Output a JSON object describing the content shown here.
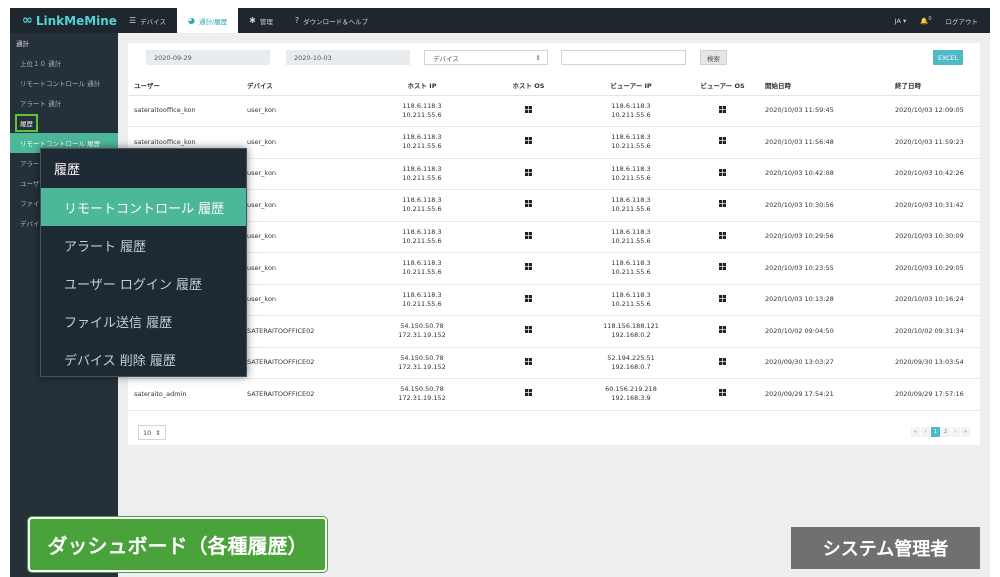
{
  "app": {
    "logo_text": "LinkMeMine"
  },
  "nav": {
    "tabs": [
      {
        "label": "デバイス",
        "icon": "list-icon"
      },
      {
        "label": "通計/履歴",
        "icon": "pie-chart-icon"
      },
      {
        "label": "管理",
        "icon": "gear-icon"
      },
      {
        "label": "ダウンロード＆ヘルプ",
        "icon": "help-icon"
      }
    ],
    "lang": "JA ▾",
    "bell_count": "0",
    "logout": "ログアウト"
  },
  "sidebar": {
    "items": [
      "通計",
      "上位１０ 通計",
      "リモートコントロール 通計",
      "アラート 通計",
      "履歴",
      "リモートコントロール 履歴",
      "アラート 履歴",
      "ユーザー ログイン 履歴",
      "ファイル送信 履歴",
      "デバイス 削除 履歴"
    ]
  },
  "filters": {
    "date_from": "2020-09-29",
    "date_to": "2020-10-03",
    "device_select": "デバイス",
    "search_value": "",
    "search_button": "検索",
    "excel_button": "EXCEL"
  },
  "table": {
    "headers": [
      "ユーザー",
      "デバイス",
      "ホスト IP",
      "ホスト OS",
      "ビューアー IP",
      "ビューアー OS",
      "開始日時",
      "終了日時"
    ],
    "rows": [
      {
        "user": "sateraitooffice_kon",
        "device": "user_kon",
        "host_ip1": "118.6.118.3",
        "host_ip2": "10.211.55.6",
        "viewer_ip1": "118.6.118.3",
        "viewer_ip2": "10.211.55.6",
        "start": "2020/10/03 11:59:45",
        "end": "2020/10/03 12:09:05"
      },
      {
        "user": "sateraitooffice_kon",
        "device": "user_kon",
        "host_ip1": "118.6.118.3",
        "host_ip2": "10.211.55.6",
        "viewer_ip1": "118.6.118.3",
        "viewer_ip2": "10.211.55.6",
        "start": "2020/10/03 11:56:48",
        "end": "2020/10/03 11:59:23"
      },
      {
        "user": "",
        "device": "user_kon",
        "host_ip1": "118.6.118.3",
        "host_ip2": "10.211.55.6",
        "viewer_ip1": "118.6.118.3",
        "viewer_ip2": "10.211.55.6",
        "start": "2020/10/03 10:42:08",
        "end": "2020/10/03 10:42:26"
      },
      {
        "user": "",
        "device": "user_kon",
        "host_ip1": "118.6.118.3",
        "host_ip2": "10.211.55.6",
        "viewer_ip1": "118.6.118.3",
        "viewer_ip2": "10.211.55.6",
        "start": "2020/10/03 10:30:56",
        "end": "2020/10/03 10:31:42"
      },
      {
        "user": "",
        "device": "user_kon",
        "host_ip1": "118.6.118.3",
        "host_ip2": "10.211.55.6",
        "viewer_ip1": "118.6.118.3",
        "viewer_ip2": "10.211.55.6",
        "start": "2020/10/03 10:29:56",
        "end": "2020/10/03 10:30:09"
      },
      {
        "user": "",
        "device": "user_kon",
        "host_ip1": "118.6.118.3",
        "host_ip2": "10.211.55.6",
        "viewer_ip1": "118.6.118.3",
        "viewer_ip2": "10.211.55.6",
        "start": "2020/10/03 10:23:55",
        "end": "2020/10/03 10:29:05"
      },
      {
        "user": "",
        "device": "user_kon",
        "host_ip1": "118.6.118.3",
        "host_ip2": "10.211.55.6",
        "viewer_ip1": "118.6.118.3",
        "viewer_ip2": "10.211.55.6",
        "start": "2020/10/03 10:13:28",
        "end": "2020/10/03 10:16:24"
      },
      {
        "user": "",
        "device": "SATERAITOOFFICE02",
        "host_ip1": "54.150.50.78",
        "host_ip2": "172.31.19.152",
        "viewer_ip1": "118.156.188.121",
        "viewer_ip2": "192.168.0.2",
        "start": "2020/10/02 09:04:50",
        "end": "2020/10/02 09:31:34"
      },
      {
        "user": "",
        "device": "SATERAITOOFFICE02",
        "host_ip1": "54.150.50.78",
        "host_ip2": "172.31.19.152",
        "viewer_ip1": "52.194.225.51",
        "viewer_ip2": "192.168.0.7",
        "start": "2020/09/30 13:03:27",
        "end": "2020/09/30 13:03:54"
      },
      {
        "user": "sateraito_admin",
        "device": "SATERAITOOFFICE02",
        "host_ip1": "54.150.50.78",
        "host_ip2": "172.31.19.152",
        "viewer_ip1": "60.156.219.218",
        "viewer_ip2": "192.168.3.9",
        "start": "2020/09/29 17:54:21",
        "end": "2020/09/29 17:57:16"
      }
    ]
  },
  "pagination": {
    "per_page": "10",
    "pages": [
      "«",
      "‹",
      "1",
      "2",
      "›",
      "»"
    ],
    "current_page": "1"
  },
  "popup": {
    "title": "履歴",
    "items": [
      "リモートコントロール 履歴",
      "アラート 履歴",
      "ユーザー ログイン 履歴",
      "ファイル送信 履歴",
      "デバイス 削除 履歴"
    ]
  },
  "captions": {
    "dashboard": "ダッシュボード（各種履歴）",
    "role": "システム管理者"
  },
  "colors": {
    "accent": "#4db79a",
    "teal": "#4fb9c6",
    "nav_bg": "#20262e",
    "sidebar_bg": "#263039"
  }
}
